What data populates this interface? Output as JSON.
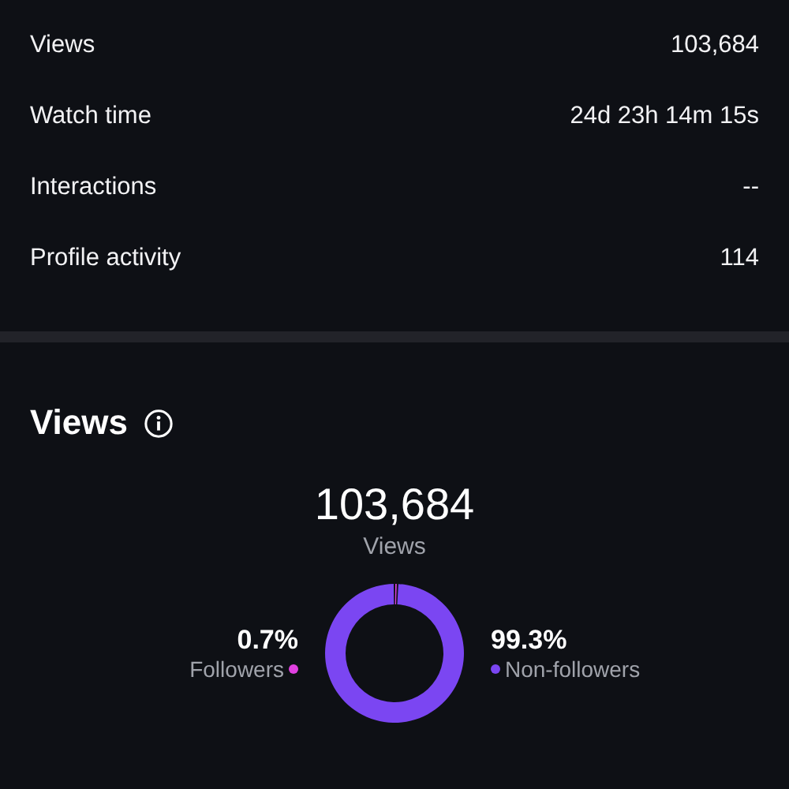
{
  "metrics": [
    {
      "label": "Views",
      "value": "103,684"
    },
    {
      "label": "Watch time",
      "value": "24d 23h 14m 15s"
    },
    {
      "label": "Interactions",
      "value": "--"
    },
    {
      "label": "Profile activity",
      "value": "114"
    }
  ],
  "views_section": {
    "title": "Views",
    "total": "103,684",
    "legend": [
      {
        "percent": "0.7%",
        "color": "#e040e0"
      },
      {
        "percent": "99.3%",
        "color": "#7b46f2"
      }
    ],
    "chart_data": {
      "type": "donut",
      "categories": [
        "Followers",
        "Non-followers"
      ],
      "series": [
        {
          "name": "Views",
          "values": [
            0.7,
            99.3
          ]
        }
      ]
    }
  }
}
